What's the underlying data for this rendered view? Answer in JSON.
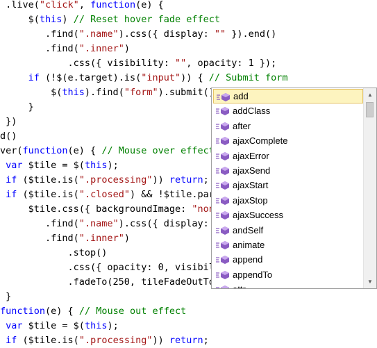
{
  "code_lines": [
    {
      "segments": [
        {
          "t": " .live(",
          "c": ""
        },
        {
          "t": "\"click\"",
          "c": "s"
        },
        {
          "t": ", ",
          "c": ""
        },
        {
          "t": "function",
          "c": "k"
        },
        {
          "t": "(e) {",
          "c": ""
        }
      ]
    },
    {
      "segments": [
        {
          "t": "     $(",
          "c": ""
        },
        {
          "t": "this",
          "c": "k"
        },
        {
          "t": ") ",
          "c": ""
        },
        {
          "t": "// Reset hover fade effect",
          "c": "c"
        }
      ]
    },
    {
      "segments": [
        {
          "t": "        .find(",
          "c": ""
        },
        {
          "t": "\".name\"",
          "c": "s"
        },
        {
          "t": ").css({ display: ",
          "c": ""
        },
        {
          "t": "\"\"",
          "c": "s"
        },
        {
          "t": " }).end()",
          "c": ""
        }
      ]
    },
    {
      "segments": [
        {
          "t": "        .find(",
          "c": ""
        },
        {
          "t": "\".inner\"",
          "c": "s"
        },
        {
          "t": ")",
          "c": ""
        }
      ]
    },
    {
      "segments": [
        {
          "t": "            .css({ visibility: ",
          "c": ""
        },
        {
          "t": "\"\"",
          "c": "s"
        },
        {
          "t": ", opacity: 1 });",
          "c": ""
        }
      ]
    },
    {
      "segments": [
        {
          "t": "     ",
          "c": ""
        },
        {
          "t": "if",
          "c": "k"
        },
        {
          "t": " (!$(e.target).is(",
          "c": ""
        },
        {
          "t": "\"input\"",
          "c": "s"
        },
        {
          "t": ")) { ",
          "c": ""
        },
        {
          "t": "// Submit form",
          "c": "c"
        }
      ]
    },
    {
      "segments": [
        {
          "t": "         $(",
          "c": ""
        },
        {
          "t": "this",
          "c": "k"
        },
        {
          "t": ").find(",
          "c": ""
        },
        {
          "t": "\"form\"",
          "c": "s"
        },
        {
          "t": ").submit().",
          "c": ""
        }
      ]
    },
    {
      "segments": [
        {
          "t": "     }",
          "c": ""
        }
      ]
    },
    {
      "segments": [
        {
          "t": " })",
          "c": ""
        }
      ]
    },
    {
      "segments": [
        {
          "t": "d()",
          "c": ""
        }
      ]
    },
    {
      "segments": [
        {
          "t": "ver(",
          "c": ""
        },
        {
          "t": "function",
          "c": "k"
        },
        {
          "t": "(e) { ",
          "c": ""
        },
        {
          "t": "// Mouse over effect",
          "c": "c"
        }
      ]
    },
    {
      "segments": [
        {
          "t": " ",
          "c": ""
        },
        {
          "t": "var",
          "c": "k"
        },
        {
          "t": " $tile = $(",
          "c": ""
        },
        {
          "t": "this",
          "c": "k"
        },
        {
          "t": ");",
          "c": ""
        }
      ]
    },
    {
      "segments": [
        {
          "t": " ",
          "c": ""
        },
        {
          "t": "if",
          "c": "k"
        },
        {
          "t": " ($tile.is(",
          "c": ""
        },
        {
          "t": "\".processing\"",
          "c": "s"
        },
        {
          "t": ")) ",
          "c": ""
        },
        {
          "t": "return",
          "c": "k"
        },
        {
          "t": ";",
          "c": ""
        }
      ]
    },
    {
      "segments": [
        {
          "t": " ",
          "c": ""
        },
        {
          "t": "if",
          "c": "k"
        },
        {
          "t": " ($tile.is(",
          "c": ""
        },
        {
          "t": "\".closed\"",
          "c": "s"
        },
        {
          "t": ") && !$tile.pare",
          "c": ""
        }
      ]
    },
    {
      "segments": [
        {
          "t": "     $tile.css({ backgroundImage: ",
          "c": ""
        },
        {
          "t": "\"none",
          "c": "s"
        }
      ]
    },
    {
      "segments": [
        {
          "t": "        .find(",
          "c": ""
        },
        {
          "t": "\".name\"",
          "c": "s"
        },
        {
          "t": ").css({ display:",
          "c": ""
        }
      ]
    },
    {
      "segments": [
        {
          "t": "        .find(",
          "c": ""
        },
        {
          "t": "\".inner\"",
          "c": "s"
        },
        {
          "t": ")",
          "c": ""
        }
      ]
    },
    {
      "segments": [
        {
          "t": "            .stop()",
          "c": ""
        }
      ]
    },
    {
      "segments": [
        {
          "t": "            .css({ opacity: 0, visibil",
          "c": ""
        }
      ]
    },
    {
      "segments": [
        {
          "t": "            .fadeTo(250, tileFadeOutTo",
          "c": ""
        }
      ]
    },
    {
      "segments": [
        {
          "t": " }",
          "c": ""
        }
      ]
    },
    {
      "segments": [
        {
          "t": "function",
          "c": "k"
        },
        {
          "t": "(e) { ",
          "c": ""
        },
        {
          "t": "// Mouse out effect",
          "c": "c"
        }
      ]
    },
    {
      "segments": [
        {
          "t": " ",
          "c": ""
        },
        {
          "t": "var",
          "c": "k"
        },
        {
          "t": " $tile = $(",
          "c": ""
        },
        {
          "t": "this",
          "c": "k"
        },
        {
          "t": ");",
          "c": ""
        }
      ]
    },
    {
      "segments": [
        {
          "t": " ",
          "c": ""
        },
        {
          "t": "if",
          "c": "k"
        },
        {
          "t": " ($tile.is(",
          "c": ""
        },
        {
          "t": "\".processing\"",
          "c": "s"
        },
        {
          "t": ")) ",
          "c": ""
        },
        {
          "t": "return",
          "c": "k"
        },
        {
          "t": ";",
          "c": ""
        }
      ]
    }
  ],
  "colors": {
    "string": "#a31515",
    "keyword": "#0000ff",
    "comment": "#008000",
    "selection_bg": "#fdf4bf",
    "selection_border": "#e5c365",
    "method_icon": "#8a5cc2"
  },
  "completion": {
    "items": [
      {
        "label": "add",
        "icon": "method-icon",
        "selected": true
      },
      {
        "label": "addClass",
        "icon": "method-icon"
      },
      {
        "label": "after",
        "icon": "method-icon"
      },
      {
        "label": "ajaxComplete",
        "icon": "method-icon"
      },
      {
        "label": "ajaxError",
        "icon": "method-icon"
      },
      {
        "label": "ajaxSend",
        "icon": "method-icon"
      },
      {
        "label": "ajaxStart",
        "icon": "method-icon"
      },
      {
        "label": "ajaxStop",
        "icon": "method-icon"
      },
      {
        "label": "ajaxSuccess",
        "icon": "method-icon"
      },
      {
        "label": "andSelf",
        "icon": "method-icon"
      },
      {
        "label": "animate",
        "icon": "method-icon"
      },
      {
        "label": "append",
        "icon": "method-icon"
      },
      {
        "label": "appendTo",
        "icon": "method-icon"
      },
      {
        "label": "attr",
        "icon": "method-icon"
      }
    ],
    "scroll_up_icon": "scroll-up-icon",
    "scroll_down_icon": "scroll-down-icon"
  }
}
